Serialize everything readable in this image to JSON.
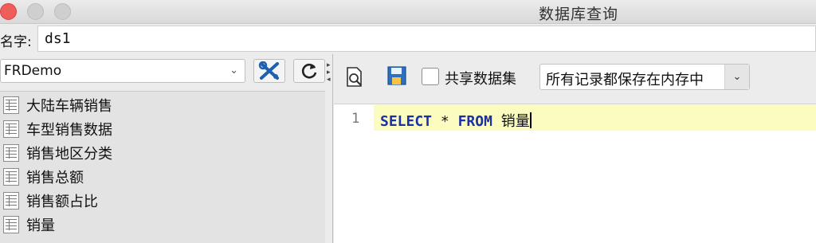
{
  "window": {
    "title": "数据库查询"
  },
  "name_row": {
    "label": "名字:",
    "value": "ds1"
  },
  "left": {
    "datasource": "FRDemo",
    "tables": [
      "大陆车辆销售",
      "车型销售数据",
      "销售地区分类",
      "销售总额",
      "销售额占比",
      "销量"
    ]
  },
  "toolbar": {
    "share_label": "共享数据集",
    "share_checked": false,
    "memory_option": "所有记录都保存在内存中"
  },
  "editor": {
    "line_number": "1",
    "kw_select": "SELECT",
    "star": "*",
    "kw_from": "FROM",
    "table": "销量"
  },
  "colors": {
    "keyword": "#1b2fa6",
    "active_line": "#fdfcc0",
    "close_button": "#ee5f5b"
  },
  "icons": [
    "close-icon",
    "minimize-icon",
    "maximize-icon",
    "chevron-down-icon",
    "tools-icon",
    "refresh-icon",
    "table-icon",
    "preview-icon",
    "save-icon"
  ]
}
